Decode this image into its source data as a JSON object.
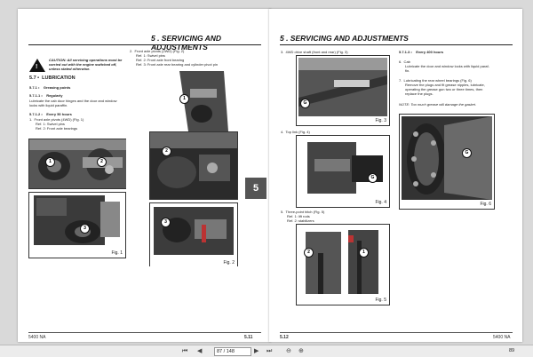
{
  "left_page": {
    "header": "5 . SERVICING AND ADJUSTMENTS",
    "warning": {
      "line1": "CAUTION: All servicing operations must be",
      "line2": "carried out with the engine switched off,",
      "line3": "unless stated otherwise."
    },
    "s57": "5.7 •  LUBRICATION",
    "s571": "5.7.1 •    Greasing points",
    "s5711": "5.7.1.1 •    Regularly",
    "p1a": "Lubricate the cab door hinges and the door and window",
    "p1b": "locks with liquid paraffin.",
    "s5712": "5.7.1.2 •    Every 50 hours",
    "i1": "1.  Front axle pivots (4WD) (Fig. 1)",
    "i1r1": "Ref. 1: Swivel pins",
    "i1r2": "Ref. 2: Front axle bearings",
    "i2": "2.  Front axle pivots (2WD) (Fig. 2)",
    "i2r1": "Ref. 1: Swivel pins",
    "i2r2": "Ref. 2: Front axle front bearing",
    "i2r3": "Ref. 3: Front axle rear bearing and cylinder pivot pin",
    "fig1": "Fig. 1",
    "fig2": "Fig. 2",
    "footer_left": "5400 NA",
    "footer_right": "5.11",
    "tab": "5"
  },
  "right_page": {
    "header": "5 . SERVICING AND ADJUSTMENTS",
    "i3": "3.  4WD drive shaft (front and rear) (Fig. 3)",
    "i4": "4.  Top link (Fig. 4)",
    "i5": "5.  Three-point hitch (Fig. 5)",
    "i5r1": "Ref. 1: lift rods",
    "i5r2": "Ref. 2: stabilizers",
    "s5713": "5.7.1.3 •    Every 400 hours",
    "i6": "6.  Cab",
    "i6a": "Lubricate the door and window locks with liquid paraf-",
    "i6b": "fin.",
    "i7": "7.  Lubricating the rear wheel bearings (Fig. 6)",
    "i7a": "Remove the plugs and fit grease nipples, lubricate,",
    "i7b": "operating the grease gun two or three times, then",
    "i7c": "replace the plugs.",
    "note": "NOTE: Too much grease will damage the gasket.",
    "fig3": "Fig. 3",
    "fig4": "Fig. 4",
    "fig5": "Fig. 5",
    "fig6": "Fig. 6",
    "footer_left": "5.12",
    "footer_right": "5400 NA"
  },
  "toolbar": {
    "first": "⏮",
    "prev": "◀",
    "page_value": "87 / 148",
    "next": "▶",
    "last": "⏭",
    "zoom_out": "⊖",
    "zoom_in": "⊕",
    "zoom_value": "89"
  }
}
